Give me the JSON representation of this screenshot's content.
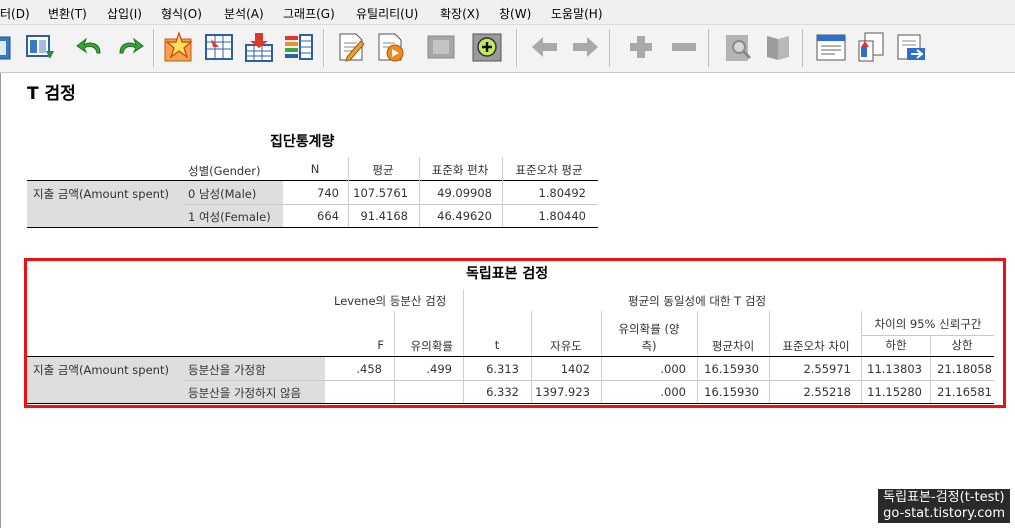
{
  "menu": [
    "터(D)",
    "변환(T)",
    "삽입(I)",
    "형식(O)",
    "분석(A)",
    "그래프(G)",
    "유틸리티(U)",
    "확장(X)",
    "창(W)",
    "도움말(H)"
  ],
  "toolbar": {
    "icons": [
      "dialog-recall-icon",
      "goto-case-icon",
      "undo-icon",
      "redo-icon",
      "select-cases-icon",
      "weight-cases-icon",
      "insert-variable-icon",
      "split-file-icon",
      "value-labels-icon",
      "use-sets-icon",
      "show-all-icon",
      "designate-window-icon",
      "back-icon",
      "forward-icon",
      "expand-icon",
      "collapse-icon",
      "zoom-icon",
      "book-icon",
      "insert-heading-icon",
      "insert-title-icon",
      "insert-text-icon"
    ]
  },
  "output": {
    "title": "T 검정",
    "group_stats": {
      "caption": "집단통계량",
      "headers": {
        "group": "성별(Gender)",
        "n": "N",
        "mean": "평균",
        "sd": "표준화 편차",
        "se": "표준오차 평균"
      },
      "variable": "지출 금액(Amount spent)",
      "rows": [
        {
          "group": "0 남성(Male)",
          "n": "740",
          "mean": "107.5761",
          "sd": "49.09908",
          "se": "1.80492"
        },
        {
          "group": "1 여성(Female)",
          "n": "664",
          "mean": "91.4168",
          "sd": "46.49620",
          "se": "1.80440"
        }
      ]
    },
    "ind_test": {
      "caption": "독립표본 검정",
      "headers": {
        "levene": "Levene의 등분산 검정",
        "means": "평균의 동일성에 대한 T 검정",
        "ci": "차이의 95% 신뢰구간",
        "F": "F",
        "sig": "유의확률",
        "t": "t",
        "df": "자유도",
        "sig2_line1": "유의확률 (양",
        "sig2_line2": "측)",
        "mean_diff": "평균차이",
        "se_diff": "표준오차 차이",
        "lower": "하한",
        "upper": "상한"
      },
      "variable": "지출 금액(Amount spent)",
      "rows": [
        {
          "label": "등분산을 가정함",
          "F": ".458",
          "sig": ".499",
          "t": "6.313",
          "df": "1402",
          "sig2": ".000",
          "mean_diff": "16.15930",
          "se_diff": "2.55971",
          "lower": "11.13803",
          "upper": "21.18058"
        },
        {
          "label": "등분산을 가정하지 않음",
          "F": "",
          "sig": "",
          "t": "6.332",
          "df": "1397.923",
          "sig2": ".000",
          "mean_diff": "16.15930",
          "se_diff": "2.55218",
          "lower": "11.15280",
          "upper": "21.16581"
        }
      ]
    }
  },
  "watermark": {
    "line1": "독립표본-검정(t-test)",
    "line2": "go-stat.tistory.com"
  }
}
